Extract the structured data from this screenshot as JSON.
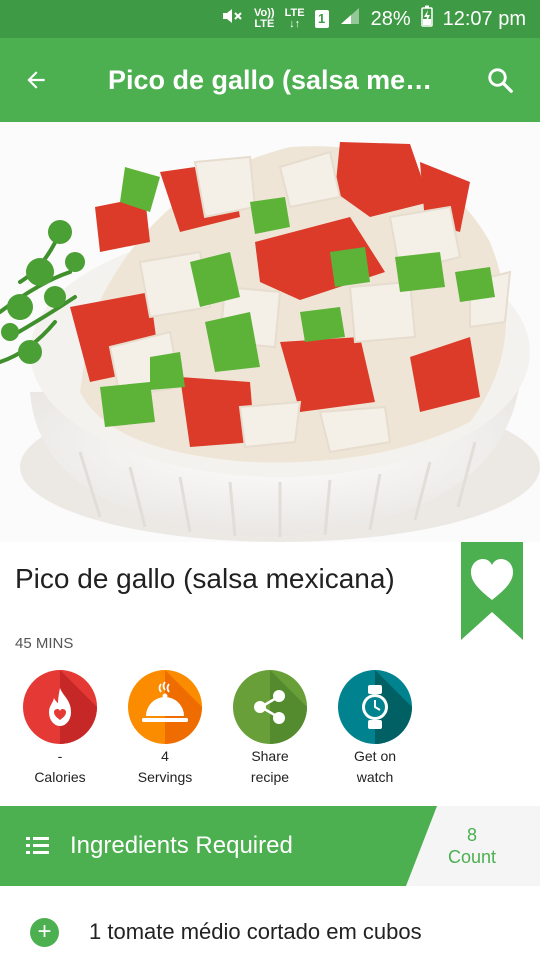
{
  "status": {
    "volte_top": "Vo))",
    "volte_bottom": "LTE",
    "lte_top": "LTE",
    "lte_bottom": "↓↑",
    "sim": "1",
    "battery": "28%",
    "time": "12:07 pm"
  },
  "app_bar": {
    "title": "Pico de gallo (salsa me…"
  },
  "recipe": {
    "title": "Pico de gallo (salsa mexicana)",
    "duration": "45 MINS"
  },
  "actions": [
    {
      "value": "-",
      "label": "Calories",
      "color": "#e53935",
      "icon": "flame-heart-icon"
    },
    {
      "value": "4",
      "label": "Servings",
      "color": "#fb8c00",
      "icon": "cloche-icon"
    },
    {
      "value": "Share",
      "label": "recipe",
      "color": "#689f38",
      "icon": "share-icon"
    },
    {
      "value": "Get on",
      "label": "watch",
      "color": "#00838f",
      "icon": "watch-icon"
    }
  ],
  "ingredients_header": {
    "title": "Ingredients Required",
    "count_value": "8",
    "count_label": "Count"
  },
  "ingredients": [
    {
      "text": "1 tomate médio cortado em cubos"
    }
  ],
  "colors": {
    "primary": "#4caf50",
    "status_bar": "#3f9a45"
  }
}
